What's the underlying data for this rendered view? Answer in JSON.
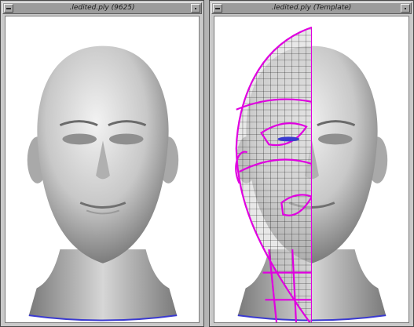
{
  "windows": [
    {
      "title": ".ledited.ply (9625)",
      "view": "scan"
    },
    {
      "title": ".ledited.ply (Template)",
      "view": "template-overlay"
    }
  ],
  "colors": {
    "background": "#b4b4b4",
    "window_frame": "#c9c9c9",
    "titlebar": "#9c9c9c",
    "viewport": "#ffffff",
    "mesh_skin": "#c4c4c4",
    "neck_edge": "#3a3ad0",
    "template_grid": "#111111",
    "template_boundary": "#e000e0"
  },
  "icons": {
    "window_menu": "window-menu-icon",
    "minimize": "minimize-icon"
  }
}
